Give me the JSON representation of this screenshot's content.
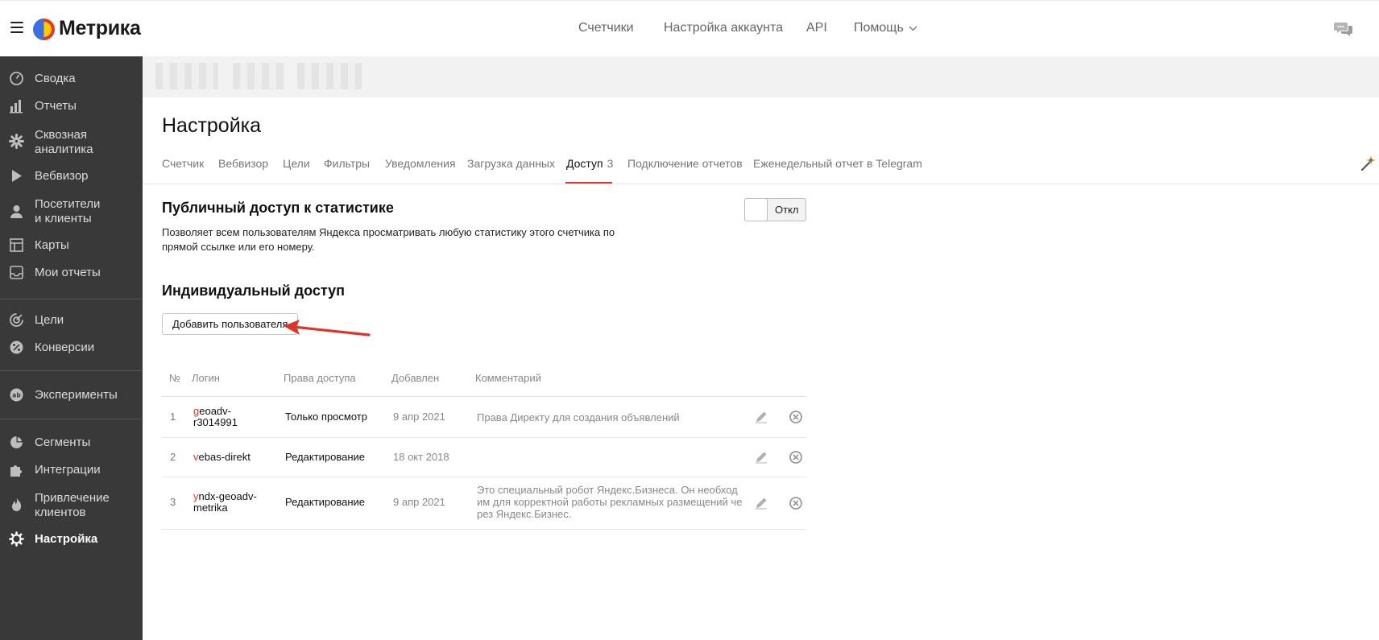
{
  "header": {
    "logo_text": "Метрика",
    "nav": [
      {
        "label": "Счетчики"
      },
      {
        "label": "Настройка аккаунта"
      },
      {
        "label": "API"
      },
      {
        "label": "Помощь"
      }
    ]
  },
  "sidebar": {
    "items": [
      {
        "label": "Сводка",
        "icon": "gauge-icon"
      },
      {
        "label": "Отчеты",
        "icon": "bar-chart-icon"
      },
      {
        "label": "Сквозная",
        "label2": "аналитика",
        "icon": "flower-icon"
      },
      {
        "label": "Вебвизор",
        "icon": "play-icon"
      },
      {
        "label": "Посетители",
        "label2": "и клиенты",
        "icon": "person-icon"
      },
      {
        "label": "Карты",
        "icon": "map-grid-icon"
      },
      {
        "label": "Мои отчеты",
        "icon": "inbox-icon"
      },
      {
        "label": "Цели",
        "icon": "target-icon"
      },
      {
        "label": "Конверсии",
        "icon": "percent-icon"
      },
      {
        "label": "Эксперименты",
        "icon": "ab-icon"
      },
      {
        "label": "Сегменты",
        "icon": "pie-icon"
      },
      {
        "label": "Интеграции",
        "icon": "puzzle-icon"
      },
      {
        "label": "Привлечение",
        "label2": "клиентов",
        "icon": "flame-icon"
      },
      {
        "label": "Настройка",
        "icon": "gear-icon",
        "active": true
      }
    ]
  },
  "page": {
    "title": "Настройка",
    "tabs": [
      {
        "label": "Счетчик"
      },
      {
        "label": "Вебвизор"
      },
      {
        "label": "Цели"
      },
      {
        "label": "Фильтры"
      },
      {
        "label": "Уведомления"
      },
      {
        "label": "Загрузка данных"
      },
      {
        "label": "Доступ",
        "badge": "3",
        "active": true
      },
      {
        "label": "Подключение отчетов"
      },
      {
        "label": "Еженедельный отчет в Telegram"
      }
    ]
  },
  "public_access": {
    "title": "Публичный доступ к статистике",
    "description": "Позволяет всем пользователям Яндекса просматривать любую статистику этого счетчика по прямой ссылке или его номеру.",
    "toggle_label": "Откл"
  },
  "individual_access": {
    "title": "Индивидуальный доступ",
    "add_button": "Добавить пользователя"
  },
  "table": {
    "columns": [
      "№",
      "Логин",
      "Права доступа",
      "Добавлен",
      "Комментарий"
    ],
    "rows": [
      {
        "num": "1",
        "login_first": "g",
        "login_rest": "eoadv-r3014991",
        "rights": "Только просмотр",
        "added": "9 апр 2021",
        "comment": "Права Директу для создания объявлений"
      },
      {
        "num": "2",
        "login_first": "v",
        "login_rest": "ebas-direkt",
        "rights": "Редактирование",
        "added": "18 окт 2018",
        "comment": ""
      },
      {
        "num": "3",
        "login_first": "y",
        "login_rest": "ndx-geoadv-metrika",
        "rights": "Редактирование",
        "added": "9 апр 2021",
        "comment": "Это специальный робот Яндекс.Бизнеса. Он необходим для корректной работы рекламных размещений через Яндекс.Бизнес."
      }
    ]
  },
  "colors": {
    "sidebar_bg": "#393939",
    "accent_red": "#e3372c",
    "annotation_arrow": "#e0332a"
  }
}
